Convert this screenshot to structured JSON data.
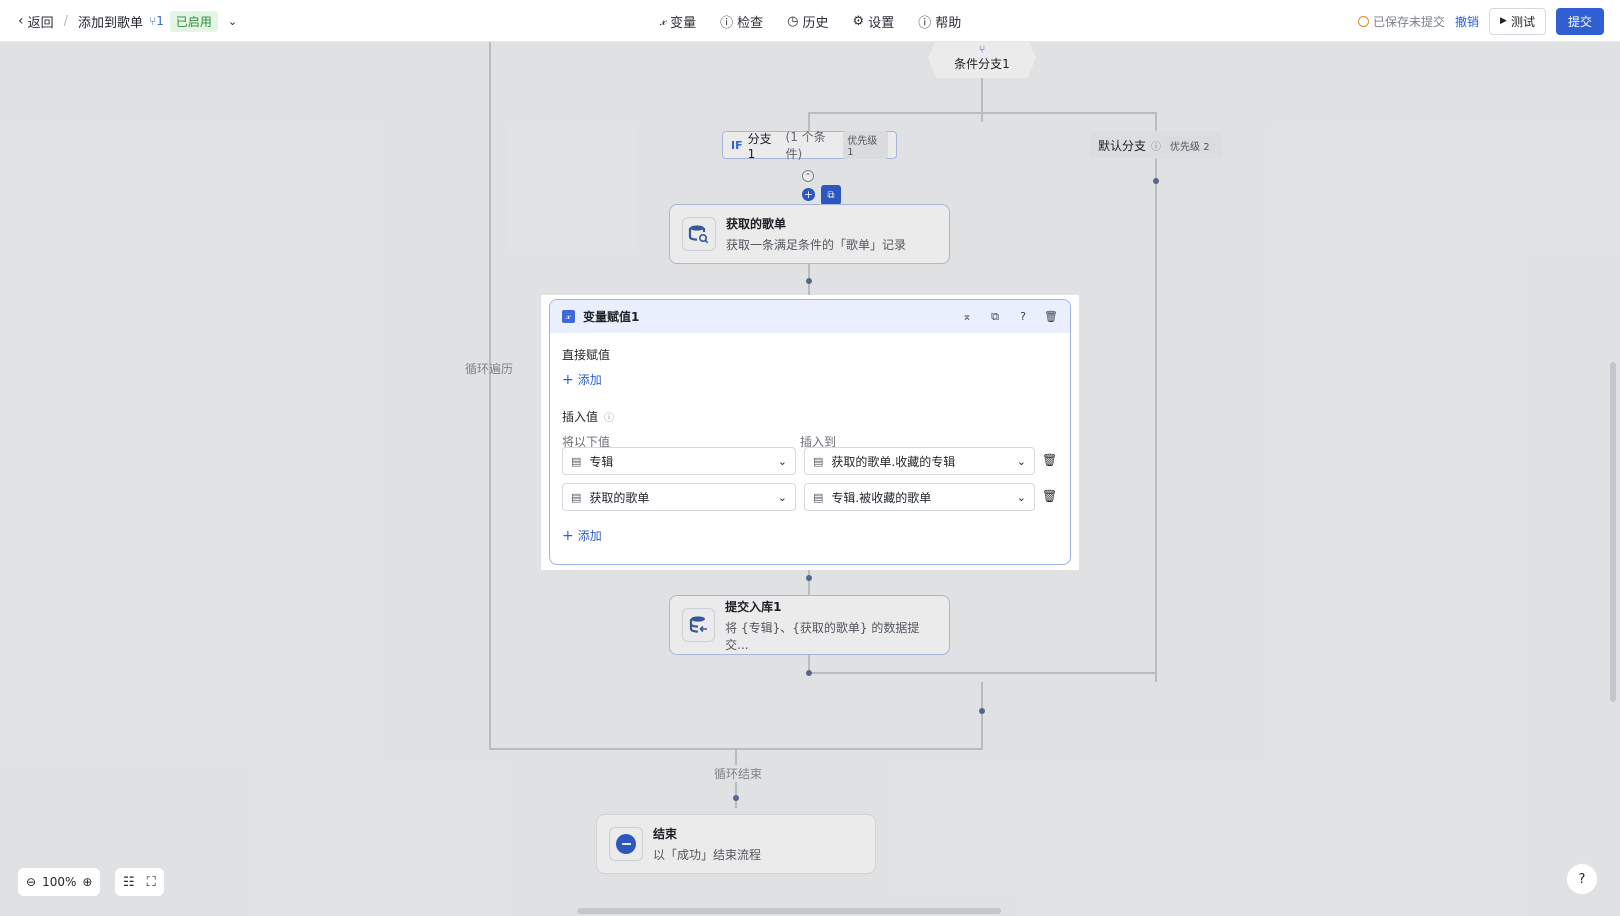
{
  "topbar": {
    "back_label": "返回",
    "separator": "/",
    "flow_name": "添加到歌单",
    "version": "1",
    "status_badge": "已启用",
    "center_items": [
      {
        "label": "变量",
        "icon": "variable-icon"
      },
      {
        "label": "检查",
        "icon": "info-circle-icon"
      },
      {
        "label": "历史",
        "icon": "history-icon"
      },
      {
        "label": "设置",
        "icon": "gear-icon"
      },
      {
        "label": "帮助",
        "icon": "question-icon"
      }
    ],
    "save_status": "已保存未提交",
    "revoke_label": "撤销",
    "test_label": "测试",
    "submit_label": "提交"
  },
  "canvas": {
    "condition_node": {
      "label": "条件分支1"
    },
    "if_branch": {
      "prefix": "IF",
      "name": "分支 1",
      "cond": "(1 个条件)",
      "priority": "优先级 1"
    },
    "default_branch": {
      "name": "默认分支",
      "priority": "优先级 2"
    },
    "get_node": {
      "title": "获取的歌单",
      "subtitle": "获取一条满足条件的「歌单」记录"
    },
    "loop_label": "循环遍历",
    "submit_node": {
      "title": "提交入库1",
      "subtitle": "将 {专辑}、{获取的歌单} 的数据提交..."
    },
    "loop_end_label": "循环结束",
    "end_node": {
      "title": "结束",
      "subtitle": "以「成功」结束流程"
    }
  },
  "panel": {
    "title": "变量赋值1",
    "direct_section": "直接赋值",
    "add_label": "添加",
    "insert_section": "插入值",
    "col_from": "将以下值",
    "col_to": "插入到",
    "rows": [
      {
        "from": "专辑",
        "to": "获取的歌单.收藏的专辑"
      },
      {
        "from": "获取的歌单",
        "to": "专辑.被收藏的歌单"
      }
    ],
    "add_label_2": "添加"
  },
  "zoom": {
    "level": "100%"
  },
  "colors": {
    "accent": "#2f5fd0",
    "node_border": "#b9c6ea",
    "status_green": "#2e8b3a"
  }
}
